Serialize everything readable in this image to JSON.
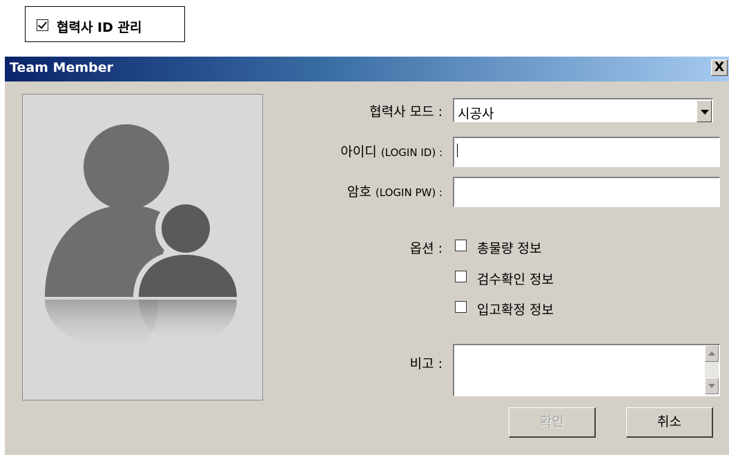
{
  "top_checkbox": {
    "label": "협력사 ID 관리",
    "checked": true
  },
  "dialog": {
    "title": "Team Member",
    "close_label": "X",
    "avatar_icon": "team-members-icon",
    "mode": {
      "label": "협력사 모드 :",
      "value": "시공사"
    },
    "login_id": {
      "label_main": "아이디 ",
      "label_sub": "(LOGIN ID) :",
      "value": ""
    },
    "login_pw": {
      "label_main": "암호 ",
      "label_sub": "(LOGIN PW) :",
      "value": ""
    },
    "options": {
      "label": "옵션 :",
      "items": [
        {
          "label": "총물량 정보",
          "checked": false
        },
        {
          "label": "검수확인 정보",
          "checked": false
        },
        {
          "label": "입고확정 정보",
          "checked": false
        }
      ]
    },
    "memo": {
      "label": "비고 :",
      "value": ""
    },
    "confirm_label": "확인",
    "cancel_label": "취소"
  }
}
